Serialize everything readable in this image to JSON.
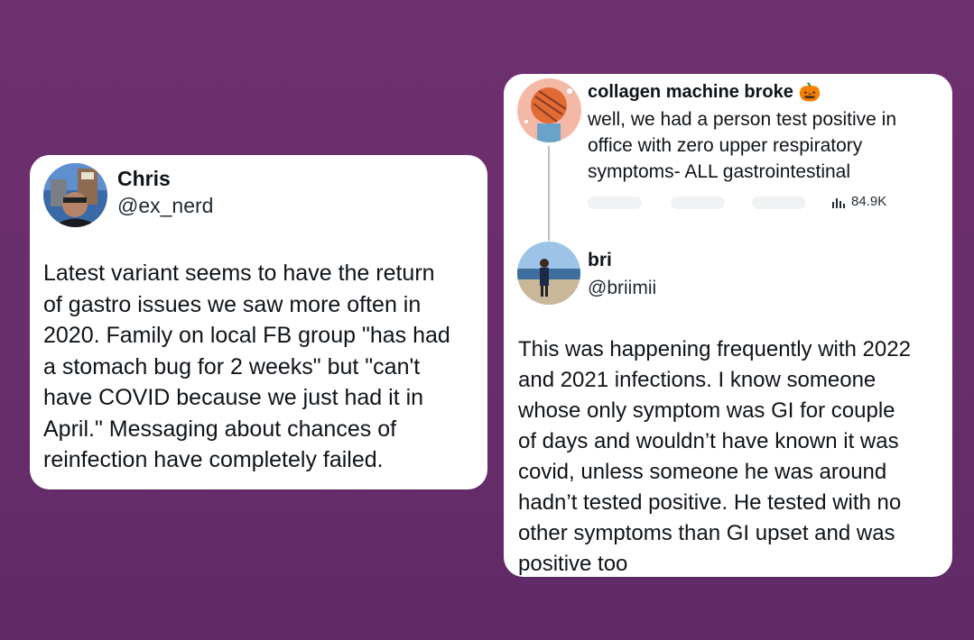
{
  "left_post": {
    "name": "Chris",
    "handle": "@ex_nerd",
    "text": "Latest variant seems to have the return\nof gastro issues we saw more often in\n2020. Family on local FB group \"has had\na stomach bug for 2 weeks\" but \"can't\nhave COVID because we just had it in\nApril.\" Messaging about chances of\nreinfection have completely failed.",
    "avatar_icon": "user-photo-avatar"
  },
  "right_post": {
    "quoted": {
      "name": "collagen machine broke",
      "name_emoji": "🎃",
      "text": "well, we had a person test positive in\noffice with zero upper respiratory\nsymptoms- ALL gastrointestinal",
      "views": "84.9K",
      "views_icon": "bar-chart-icon",
      "avatar_icon": "illustrated-avatar"
    },
    "reply": {
      "name": "bri",
      "handle": "@briimii",
      "text": "This was happening frequently with 2022\nand 2021 infections. I know someone\nwhose only symptom was GI for couple\nof days and wouldn’t have known it was\ncovid, unless someone he was around\nhadn’t tested positive. He tested with no\nother symptoms than GI upset and was\npositive too",
      "avatar_icon": "beach-photo-avatar"
    }
  },
  "colors": {
    "background": "#6a2e6c",
    "card": "#ffffff",
    "text": "#0f1419"
  }
}
